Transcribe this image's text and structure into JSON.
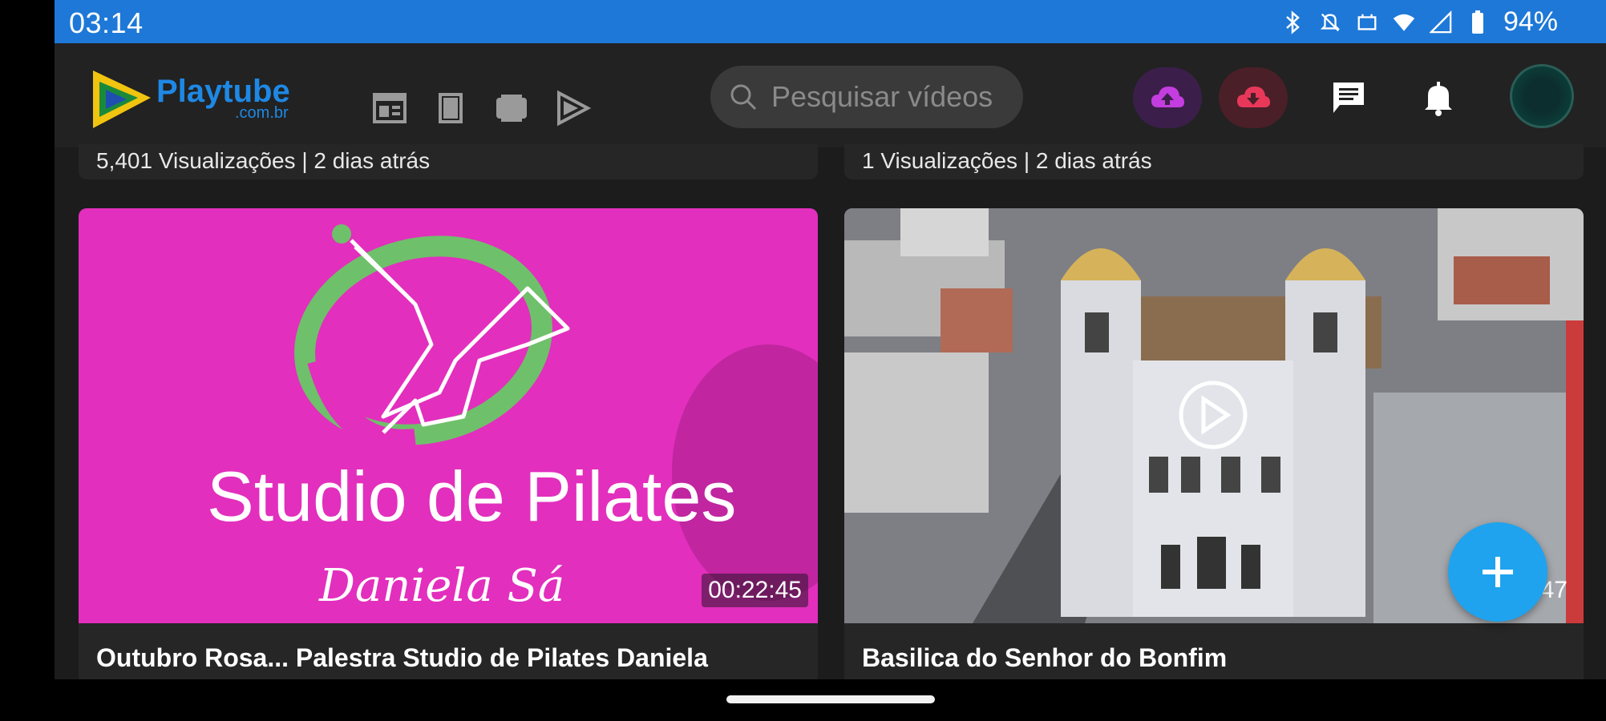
{
  "status_bar": {
    "time": "03:14",
    "battery": "94%"
  },
  "header": {
    "logo_text": "Playtube",
    "logo_sub": ".com.br",
    "search_placeholder": "Pesquisar vídeos"
  },
  "videos": [
    {
      "views_date": "5,401 Visualizações  |  2 dias atrás",
      "thumbnail_text": "Studio de Pilates",
      "thumbnail_script": "Daniela Sá",
      "duration": "00:22:45",
      "title": "Outubro Rosa... Palestra Studio de Pilates Daniela"
    },
    {
      "views_date": "1 Visualizações  |  2 dias atrás",
      "duration": "47",
      "title": "Basilica do Senhor do Bonfim"
    }
  ],
  "colors": {
    "status_bar": "#1e78d8",
    "accent": "#1fa3ee",
    "background": "#1c1c1c",
    "pilates_pink": "#e22fbd"
  }
}
